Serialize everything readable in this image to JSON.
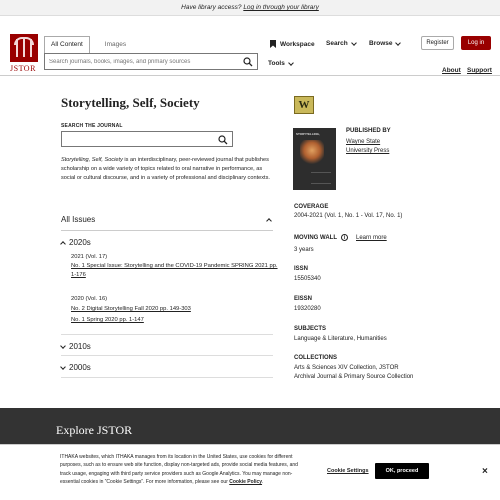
{
  "topbar": {
    "prefix": "Have library access?",
    "link": "Log in through your library"
  },
  "header": {
    "logo_text": "JSTOR",
    "tabs": [
      "All Content",
      "Images"
    ],
    "search_placeholder": "Search journals, books, images, and primary sources",
    "nav": {
      "workspace": "Workspace",
      "search": "Search",
      "browse": "Browse",
      "tools": "Tools"
    },
    "register": "Register",
    "login": "Log in",
    "about": "About",
    "support": "Support"
  },
  "journal": {
    "title": "Storytelling, Self, Society",
    "search_label": "SEARCH THE JOURNAL",
    "desc_italic": "Storytelling, Self, Society",
    "desc_rest": " is an interdisciplinary, peer-reviewed journal that publishes scholarship on a wide variety of topics related to oral narrative in performance, as social or cultural discourse, and in a variety of professional and disciplinary contexts."
  },
  "issues": {
    "header": "All Issues",
    "decades": [
      "2020s",
      "2010s",
      "2000s"
    ],
    "vol17": "2021 (Vol. 17)",
    "vol17_link": "No. 1 Special Issue: Storytelling and the COVID-19 Pandemic SPRING 2021 pp. 1-176",
    "vol16": "2020 (Vol. 16)",
    "vol16_link1": "No. 2 Digital Storytelling Fall 2020 pp. 149-303",
    "vol16_link2": "No. 1 Spring 2020 pp. 1-147"
  },
  "sidebar": {
    "badge": "W",
    "cover_title": "STORYTELLING,",
    "published_by_label": "PUBLISHED BY",
    "publisher": "Wayne State University Press",
    "coverage_label": "COVERAGE",
    "coverage": "2004-2021 (Vol. 1, No. 1 - Vol. 17, No. 1)",
    "moving_wall_label": "MOVING WALL",
    "learn_more": "Learn more",
    "moving_wall": "3 years",
    "issn_label": "ISSN",
    "issn": "15505340",
    "eissn_label": "EISSN",
    "eissn": "19320280",
    "subjects_label": "SUBJECTS",
    "subjects": "Language & Literature, Humanities",
    "collections_label": "COLLECTIONS",
    "collections": "Arts & Sciences XIV Collection, JSTOR Archival Journal & Primary Source Collection"
  },
  "footer": {
    "explore": "Explore JSTOR"
  },
  "cookie": {
    "text": "ITHAKA websites, which ITHAKA manages from its location in the United States, use cookies for different purposes, such as to ensure web site function, display non-targeted ads, provide social media features, and track usage, engaging with third party service providers such as Google Analytics. You may manage non-essential cookies in “Cookie Settings”. For more information, please see our",
    "policy": "Cookie Policy",
    "settings": "Cookie Settings",
    "ok": "OK, proceed",
    "close": "×"
  }
}
